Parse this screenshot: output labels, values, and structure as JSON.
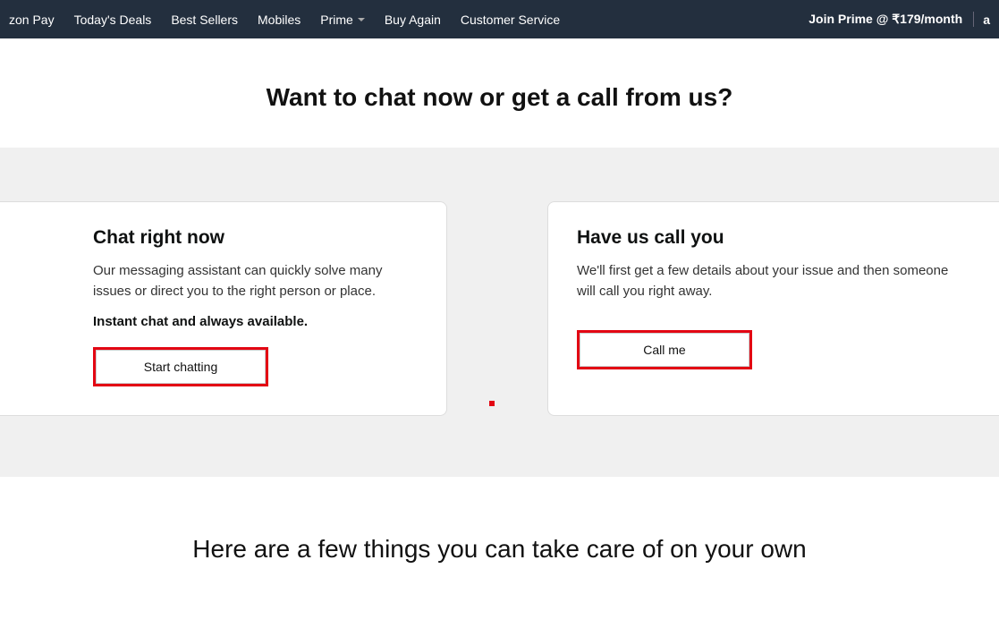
{
  "nav": {
    "items": [
      "zon Pay",
      "Today's Deals",
      "Best Sellers",
      "Mobiles",
      "Prime",
      "Buy Again",
      "Customer Service"
    ],
    "join_prime": "Join Prime @ ₹179/month",
    "right_fragment": "a"
  },
  "page_title": "Want to chat now or get a call from us?",
  "chat_card": {
    "title": "Chat right now",
    "desc": "Our messaging assistant can quickly solve many issues or direct you to the right person or place.",
    "bold": "Instant chat and always available.",
    "button": "Start chatting"
  },
  "call_card": {
    "title": "Have us call you",
    "desc": "We'll first get a few details about your issue and then someone will call you right away.",
    "button": "Call me"
  },
  "lower_title": "Here are a few things you can take care of on your own"
}
